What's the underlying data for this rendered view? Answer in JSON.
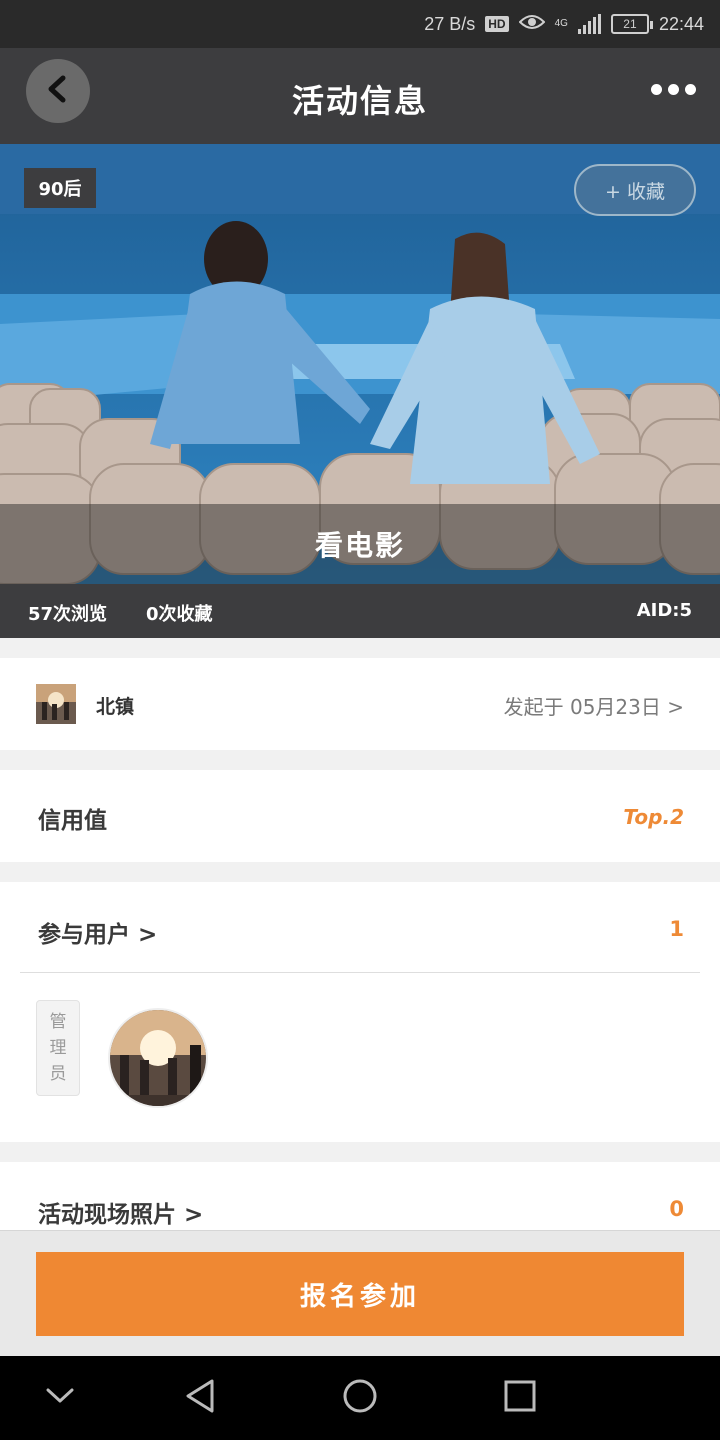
{
  "status_bar": {
    "speed": "27 B/s",
    "hd": "HD",
    "network": "4G",
    "battery": "21",
    "time": "22:44"
  },
  "header": {
    "title": "活动信息",
    "back_icon": "chevron-left-icon",
    "more_icon": "more-dots-icon"
  },
  "hero": {
    "tag": "90后",
    "favorite_label": "+ 收藏",
    "caption": "看电影"
  },
  "stats": {
    "views": "57次浏览",
    "favorites": "0次收藏",
    "aid": "AID:5"
  },
  "organizer": {
    "name": "北镇",
    "date_text": "发起于 05月23日 >"
  },
  "credit": {
    "label": "信用值",
    "value": "Top.2"
  },
  "participants": {
    "label": "参与用户 >",
    "count": "1",
    "admin_badge": [
      "管",
      "理",
      "员"
    ]
  },
  "photos": {
    "label": "活动现场照片 >",
    "count": "0"
  },
  "action": {
    "join_label": "报名参加"
  },
  "colors": {
    "accent": "#ef8833",
    "header_bg": "#3d3d3f",
    "statusbar_bg": "#2a2a2a"
  }
}
